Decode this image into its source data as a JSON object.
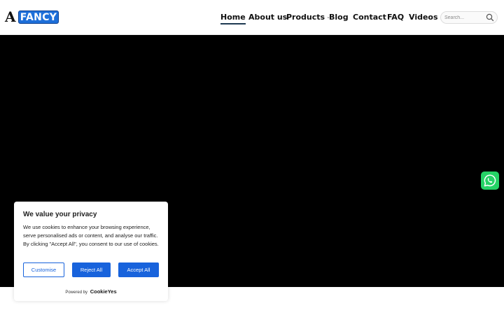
{
  "brand": {
    "letter": "A",
    "name": "FANCY"
  },
  "nav": {
    "items": [
      {
        "label": "Home"
      },
      {
        "label": "About us"
      },
      {
        "label": "Products"
      },
      {
        "label": "Blog"
      },
      {
        "label": "Contact"
      },
      {
        "label": "FAQ"
      },
      {
        "label": "Videos"
      }
    ]
  },
  "search": {
    "placeholder": "Search..."
  },
  "cookie_banner": {
    "title": "We value your privacy",
    "body": "We use cookies to enhance your browsing experience, serve personalised ads or content, and analyse our traffic. By clicking \"Accept All\", you consent to our use of cookies.",
    "customise_label": "Customise",
    "reject_label": "Reject All",
    "accept_label": "Accept All",
    "powered_by": "Powered by",
    "powered_brand": "CookieYes"
  },
  "colors": {
    "accent": "#1863dc",
    "whatsapp": "#25d366",
    "hero_bg": "#000000"
  },
  "icons": {
    "search": "search-icon",
    "whatsapp": "whatsapp-icon",
    "products_dropdown": "chevron-down-icon"
  }
}
